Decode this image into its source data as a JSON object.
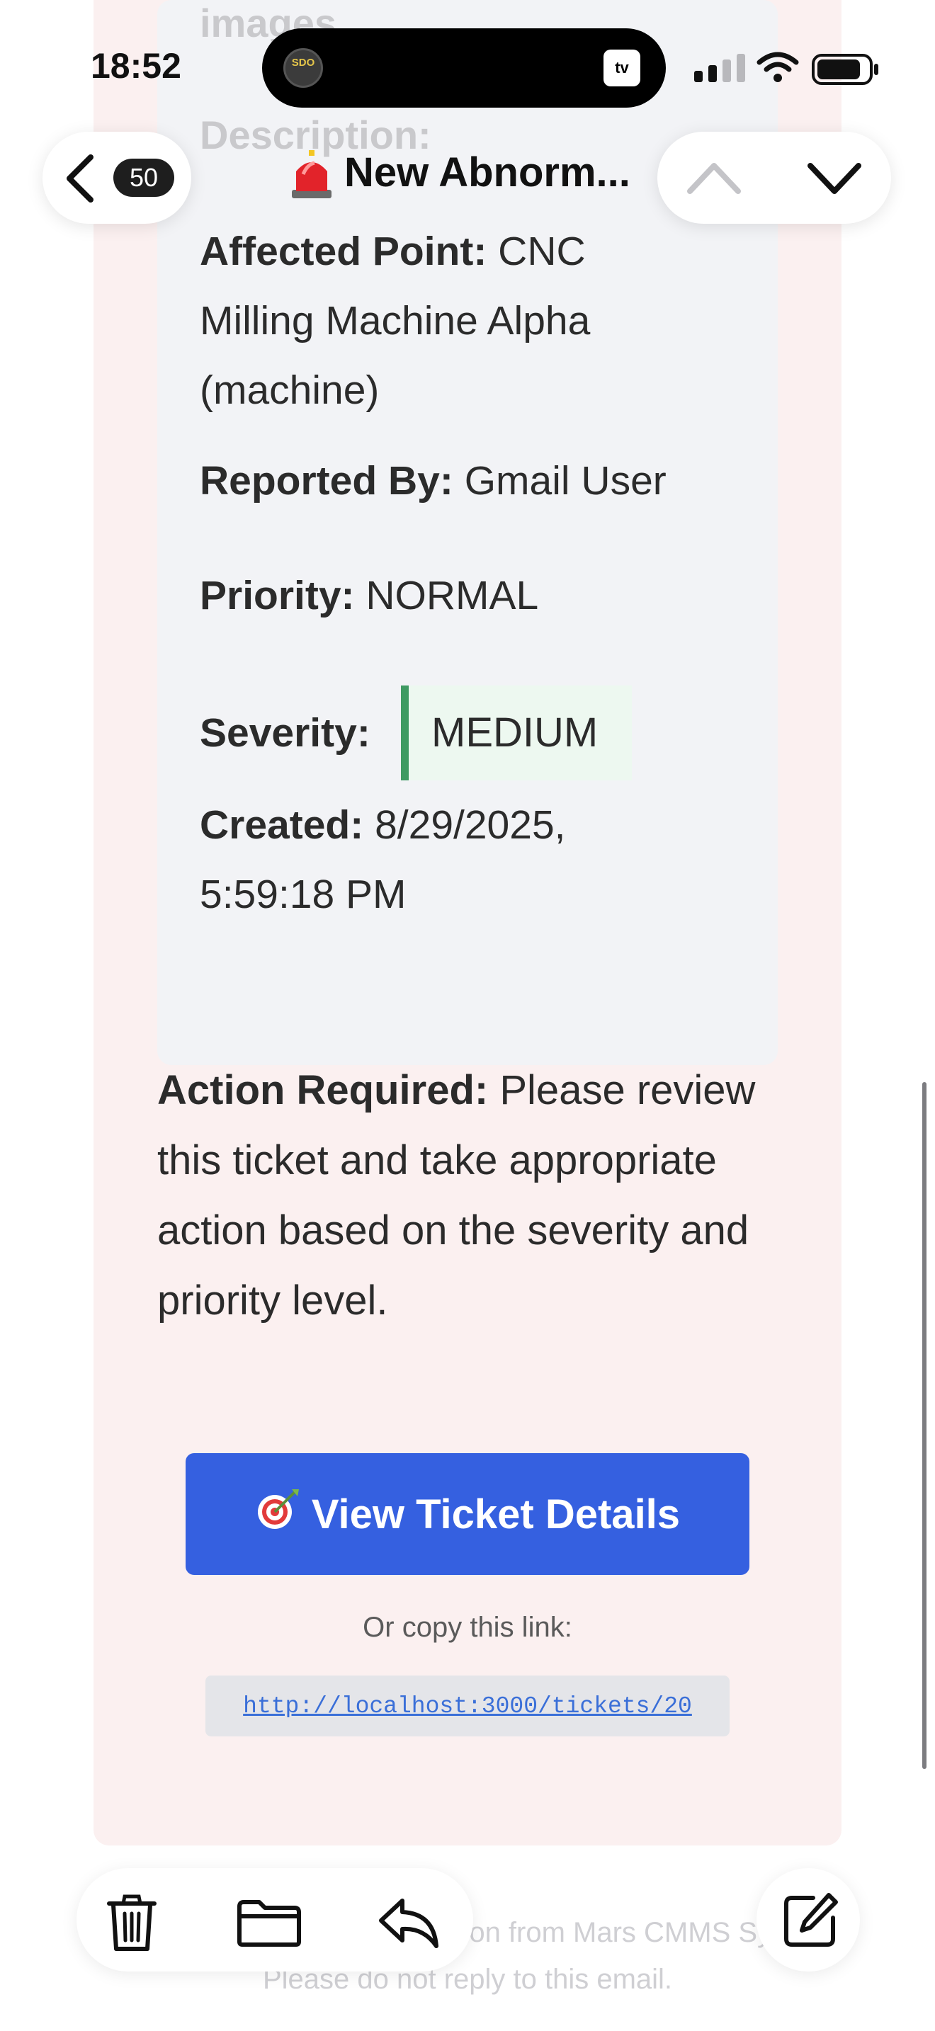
{
  "status_bar": {
    "time": "18:52",
    "island_avatar_text": "SDO",
    "island_app": "tv"
  },
  "nav": {
    "unread_count": "50",
    "title": "New Abnorm...",
    "title_icon": "siren-icon"
  },
  "email": {
    "faded_labels": [
      "images",
      "Description:"
    ],
    "details": {
      "affected_point_label": "Affected Point:",
      "affected_point_value": "CNC Milling Machine Alpha (machine)",
      "reported_by_label": "Reported By:",
      "reported_by_value": "Gmail User",
      "priority_label": "Priority:",
      "priority_value": "NORMAL",
      "severity_label": "Severity:",
      "severity_value": "MEDIUM",
      "created_label": "Created:",
      "created_value": "8/29/2025, 5:59:18 PM"
    },
    "action_required_label": "Action Required:",
    "action_required_text": "Please review this ticket and take appropriate action based on the severity and priority level.",
    "view_button_label": "View Ticket Details",
    "copy_label": "Or copy this link:",
    "copy_link": "http://localhost:3000/tickets/20",
    "footer_note": "This is an automated notification from Mars CMMS System. Please do not reply to this email."
  },
  "colors": {
    "button_blue": "#3560e0",
    "card_bg": "#fbf0f0",
    "details_bg": "#f2f3f6",
    "severity_accent": "#3f9a62",
    "link_blue": "#3a6fd8"
  },
  "toolbar": {
    "icons": [
      "trash-icon",
      "folder-icon",
      "reply-icon",
      "compose-icon"
    ]
  }
}
